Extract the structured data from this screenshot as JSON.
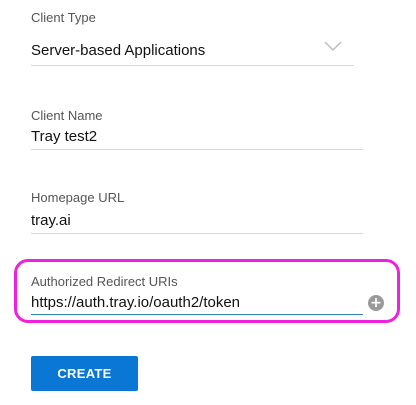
{
  "form": {
    "client_type": {
      "label": "Client Type",
      "value": "Server-based Applications",
      "icon": "chevron-down-icon"
    },
    "client_name": {
      "label": "Client Name",
      "value": "Tray test2"
    },
    "homepage_url": {
      "label": "Homepage URL",
      "value": "tray.ai"
    },
    "redirect_uris": {
      "label": "Authorized Redirect URIs",
      "value": "https://auth.tray.io/oauth2/token",
      "add_icon": "plus-circle-icon",
      "add_glyph": "+"
    },
    "create_button": {
      "label": "CREATE"
    }
  },
  "colors": {
    "highlight": "#ee22dd",
    "primary_button": "#0b77d4",
    "active_underline": "#2a8aa6",
    "underline": "#d6d6d6",
    "add_icon": "#9a9a9a"
  }
}
